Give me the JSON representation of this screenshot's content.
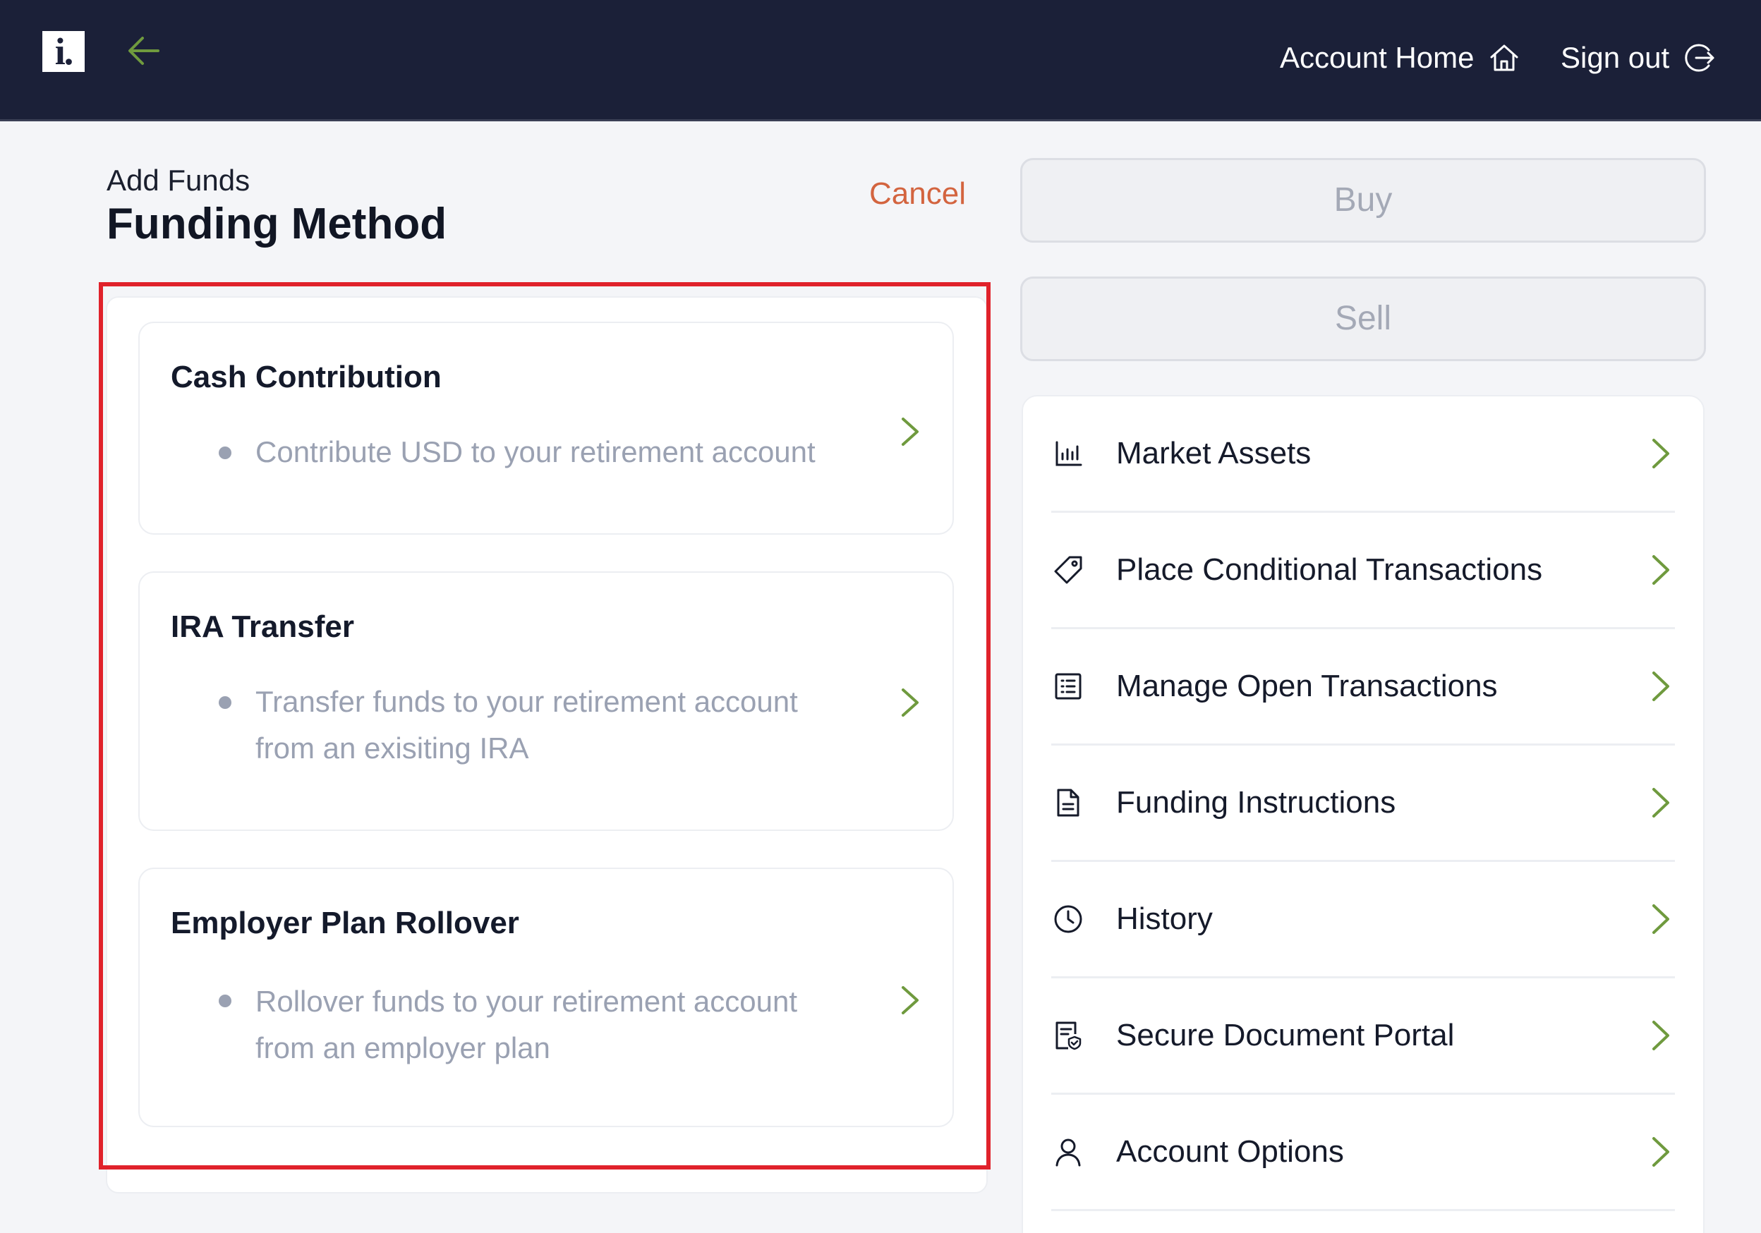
{
  "header": {
    "logo_text": "i.",
    "account_home_label": "Account Home",
    "sign_out_label": "Sign out"
  },
  "page": {
    "subtitle": "Add Funds",
    "title": "Funding Method",
    "cancel_label": "Cancel"
  },
  "funding_methods": [
    {
      "title": "Cash Contribution",
      "description": "Contribute USD to your retirement account"
    },
    {
      "title": "IRA Transfer",
      "description": "Transfer funds to your retirement account from an exisiting IRA"
    },
    {
      "title": "Employer Plan Rollover",
      "description": "Rollover funds to your retirement account from an employer plan"
    }
  ],
  "actions": {
    "buy_label": "Buy",
    "sell_label": "Sell"
  },
  "menu": [
    {
      "label": "Market Assets",
      "icon": "bar-chart-icon"
    },
    {
      "label": "Place Conditional Transactions",
      "icon": "tag-icon"
    },
    {
      "label": "Manage Open Transactions",
      "icon": "list-icon"
    },
    {
      "label": "Funding Instructions",
      "icon": "document-icon"
    },
    {
      "label": "History",
      "icon": "clock-icon"
    },
    {
      "label": "Secure Document Portal",
      "icon": "secure-document-icon"
    },
    {
      "label": "Account Options",
      "icon": "user-icon"
    }
  ],
  "colors": {
    "header_bg": "#1b2038",
    "accent_green": "#6f9a3e",
    "cancel_orange": "#d3643f",
    "highlight_red": "#e0222b"
  }
}
